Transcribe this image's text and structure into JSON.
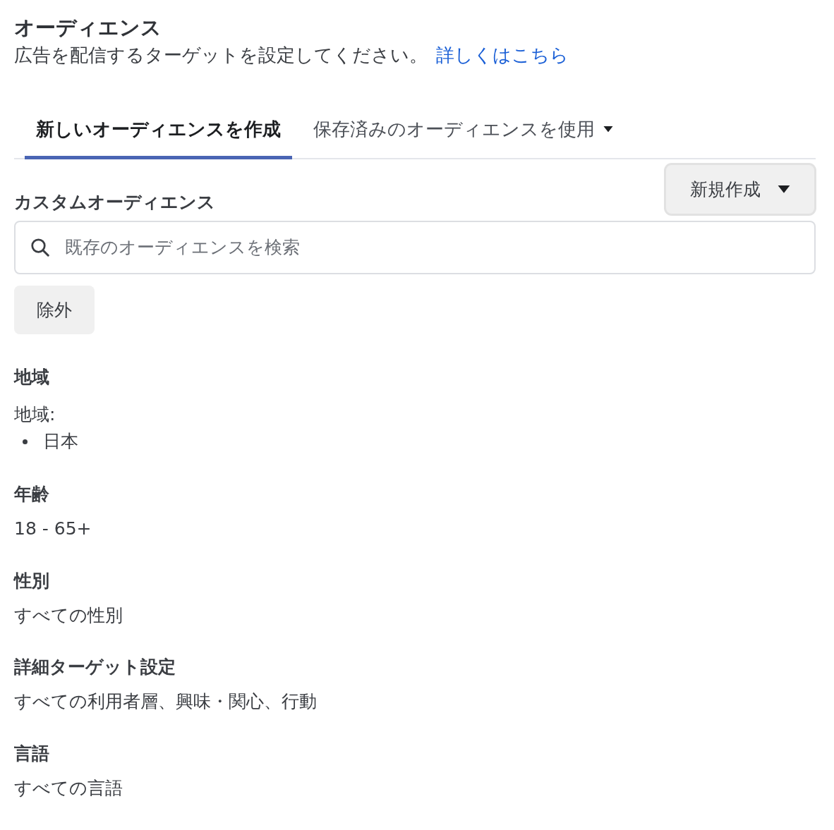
{
  "header": {
    "title": "オーディエンス",
    "description": "広告を配信するターゲットを設定してください。",
    "link": "詳しくはこちら"
  },
  "tabs": [
    {
      "label": "新しいオーディエンスを作成",
      "selected": true,
      "dropdown": false
    },
    {
      "label": "保存済みのオーディエンスを使用",
      "selected": false,
      "dropdown": true
    }
  ],
  "custom_audience": {
    "title": "カスタムオーディエンス",
    "create_button": "新規作成",
    "search": {
      "placeholder": "既存のオーディエンスを検索"
    },
    "exclude_button": "除外"
  },
  "sections": [
    {
      "title": "地域",
      "kind": "list",
      "label": "地域:",
      "items": [
        "日本"
      ]
    },
    {
      "title": "年齢",
      "kind": "text",
      "value": "18 - 65+"
    },
    {
      "title": "性別",
      "kind": "text",
      "value": "すべての性別"
    },
    {
      "title": "詳細ターゲット設定",
      "kind": "text",
      "value": "すべての利用者層、興味・関心、行動"
    },
    {
      "title": "言語",
      "kind": "text",
      "value": "すべての言語"
    }
  ]
}
